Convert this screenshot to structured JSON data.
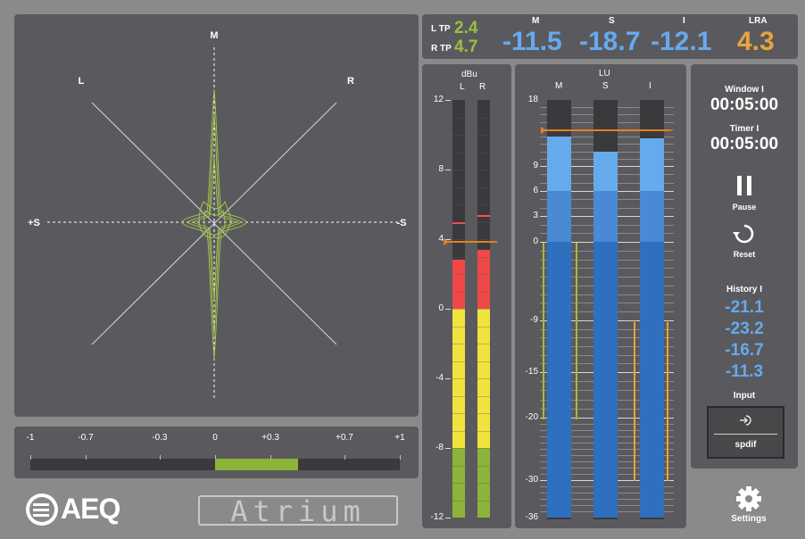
{
  "vectorscope": {
    "label_m": "M",
    "label_l": "L",
    "label_r": "R",
    "label_plus_s": "+S",
    "label_minus_s": "-S"
  },
  "correlation": {
    "ticks": [
      "-1",
      "-0.7",
      "-0.3",
      "0",
      "+0.3",
      "+0.7",
      "+1"
    ],
    "range": [
      0,
      0.45
    ],
    "color": "#8db33a"
  },
  "true_peak": {
    "l_label": "L TP",
    "l_value": "2.4",
    "r_label": "R TP",
    "r_value": "4.7"
  },
  "loudness": {
    "m_label": "M",
    "m_value": "-11.5",
    "s_label": "S",
    "s_value": "-18.7",
    "i_label": "I",
    "i_value": "-12.1",
    "lra_label": "LRA",
    "lra_value": "4.3"
  },
  "dbu_meter": {
    "title": "dBu",
    "ch_l": "L",
    "ch_r": "R",
    "scale": [
      "12",
      "8",
      "4",
      "0",
      "-4",
      "-8",
      "-12"
    ],
    "levels": {
      "L": 2.8,
      "R": 3.4
    },
    "peak_hold": {
      "L": 5.0,
      "R": 5.4
    },
    "reference": 3.9
  },
  "lu_meter": {
    "title": "LU",
    "ch_m": "M",
    "ch_s": "S",
    "ch_i": "I",
    "scale": [
      "18",
      "9",
      "6",
      "3",
      "0",
      "-9",
      "-15",
      "-20",
      "-30",
      "-36"
    ],
    "levels": {
      "M": 13,
      "S": 11,
      "I": 12.8
    },
    "target": 14
  },
  "side": {
    "window_label": "Window I",
    "window_value": "00:05:00",
    "timer_label": "Timer I",
    "timer_value": "00:05:00",
    "pause_label": "Pause",
    "reset_label": "Reset",
    "history_label": "History I",
    "history": [
      "-21.1",
      "-23.2",
      "-16.7",
      "-11.3"
    ],
    "input_label": "Input",
    "input_value": "spdif"
  },
  "footer": {
    "brand_logo": "AEQ",
    "product_logo": "Atrium",
    "settings_label": "Settings"
  },
  "colors": {
    "green": "#9bbf3f",
    "blue": "#66aaee",
    "orange": "#e8a43a",
    "panel": "#5a5a5e"
  }
}
